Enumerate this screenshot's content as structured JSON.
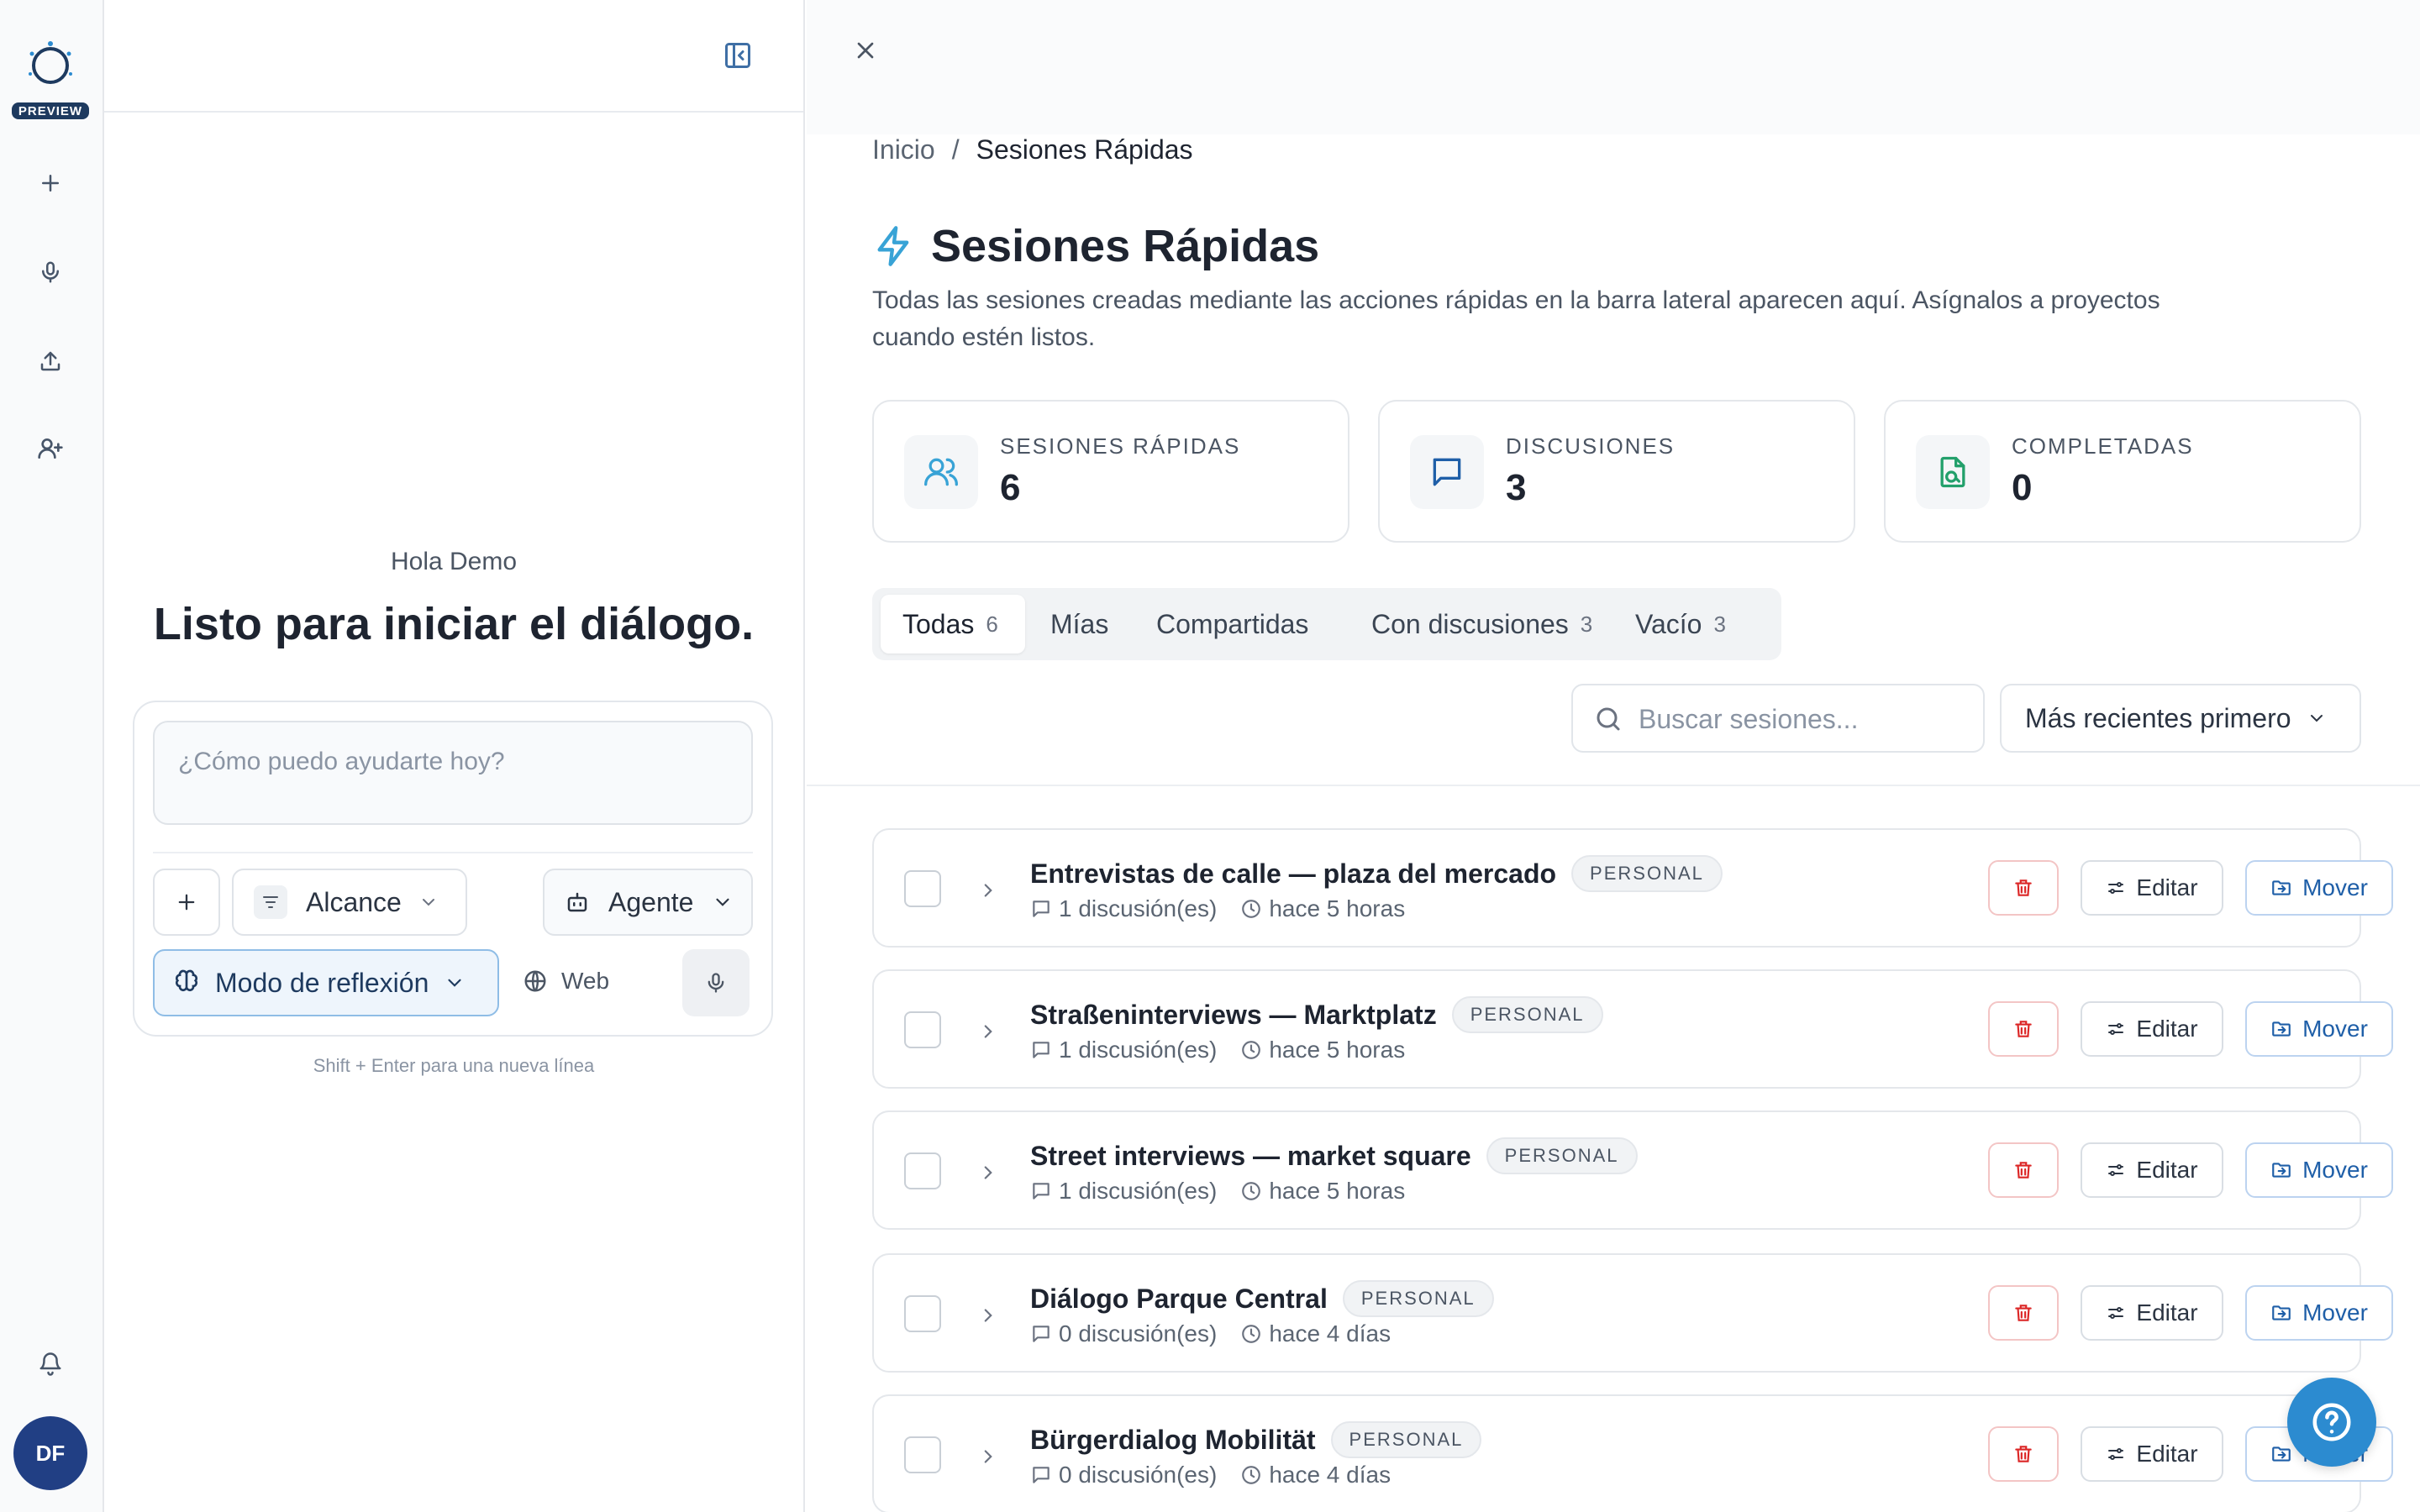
{
  "rail": {
    "preview_badge": "PREVIEW",
    "avatar_initials": "DF",
    "icons": [
      "logo-icon",
      "plus-icon",
      "mic-icon",
      "upload-icon",
      "user-plus-icon",
      "bell-icon"
    ]
  },
  "chat": {
    "greeting": "Hola Demo",
    "headline": "Listo para iniciar el diálogo.",
    "prompt_placeholder": "¿Cómo puedo ayudarte hoy?",
    "scope_label": "Alcance",
    "agent_label": "Agente",
    "reflection_label": "Modo de reflexión",
    "web_label": "Web",
    "hint": "Shift + Enter para una nueva línea"
  },
  "main": {
    "breadcrumb": {
      "home": "Inicio",
      "separator": "/",
      "current": "Sesiones Rápidas"
    },
    "title": "Sesiones Rápidas",
    "description_line1": "Todas las sesiones creadas mediante las acciones rápidas en la barra lateral aparecen aquí. Asígnalos a proyectos",
    "description_line2": "cuando estén listos.",
    "stats": [
      {
        "label": "SESIONES RÁPIDAS",
        "value": "6"
      },
      {
        "label": "DISCUSIONES",
        "value": "3"
      },
      {
        "label": "COMPLETADAS",
        "value": "0"
      }
    ],
    "tabs": [
      {
        "label": "Todas",
        "count": "6"
      },
      {
        "label": "Mías",
        "count": ""
      },
      {
        "label": "Compartidas",
        "count": ""
      },
      {
        "label": "Con discusiones",
        "count": "3"
      },
      {
        "label": "Vacío",
        "count": "3"
      }
    ],
    "search_placeholder": "Buscar sesiones...",
    "sort_label": "Más recientes primero",
    "edit_label": "Editar",
    "move_label": "Mover",
    "sessions": [
      {
        "title": "Entrevistas de calle — plaza del mercado",
        "badge": "PERSONAL",
        "discussions": "1 discusión(es)",
        "time": "hace 5 horas"
      },
      {
        "title": "Straßeninterviews — Marktplatz",
        "badge": "PERSONAL",
        "discussions": "1 discusión(es)",
        "time": "hace 5 horas"
      },
      {
        "title": "Street interviews — market square",
        "badge": "PERSONAL",
        "discussions": "1 discusión(es)",
        "time": "hace 5 horas"
      },
      {
        "title": "Diálogo Parque Central",
        "badge": "PERSONAL",
        "discussions": "0 discusión(es)",
        "time": "hace 4 días"
      },
      {
        "title": "Bürgerdialog Mobilität",
        "badge": "PERSONAL",
        "discussions": "0 discusión(es)",
        "time": "hace 4 días"
      }
    ]
  },
  "colors": {
    "accent": "#2c8bd0",
    "title_icon": "#38a3d6",
    "delete": "#dc2626",
    "move": "#1f5fa8",
    "completed_icon": "#22a06b"
  }
}
